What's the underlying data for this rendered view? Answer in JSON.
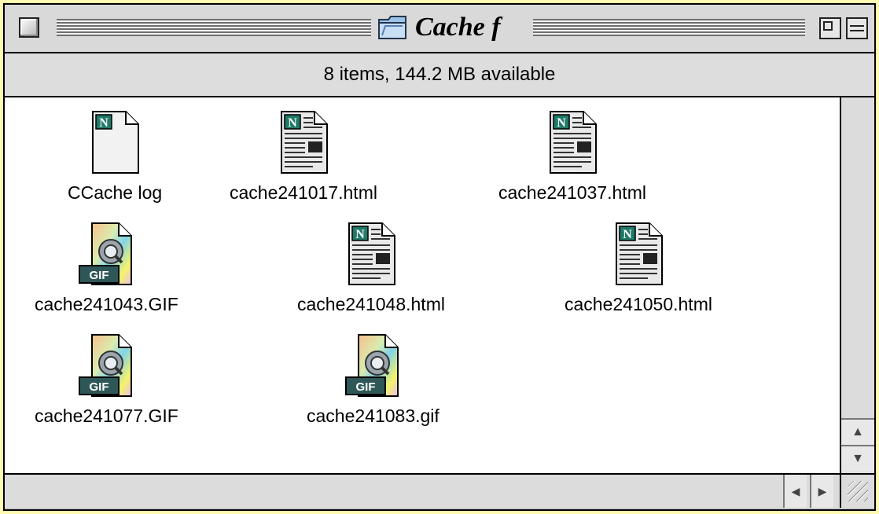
{
  "window": {
    "title": "Cache f",
    "info": "8 items, 144.2 MB available",
    "folder_icon": "folder-icon"
  },
  "items": [
    {
      "name": "CCache log",
      "kind": "netscape-document"
    },
    {
      "name": "cache241017.html",
      "kind": "netscape-html"
    },
    {
      "name": "cache241037.html",
      "kind": "netscape-html"
    },
    {
      "name": "cache241043.GIF",
      "kind": "quicktime-gif"
    },
    {
      "name": "cache241048.html",
      "kind": "netscape-html"
    },
    {
      "name": "cache241050.html",
      "kind": "netscape-html"
    },
    {
      "name": "cache241077.GIF",
      "kind": "quicktime-gif"
    },
    {
      "name": "cache241083.gif",
      "kind": "quicktime-gif"
    }
  ],
  "gif_badge": "GIF",
  "netscape_badge": "N",
  "colors": {
    "desktop": "#fefbb0",
    "window_chrome": "#d9d9d9",
    "content_bg": "#ffffff",
    "netscape_badge": "#1f7a68"
  }
}
